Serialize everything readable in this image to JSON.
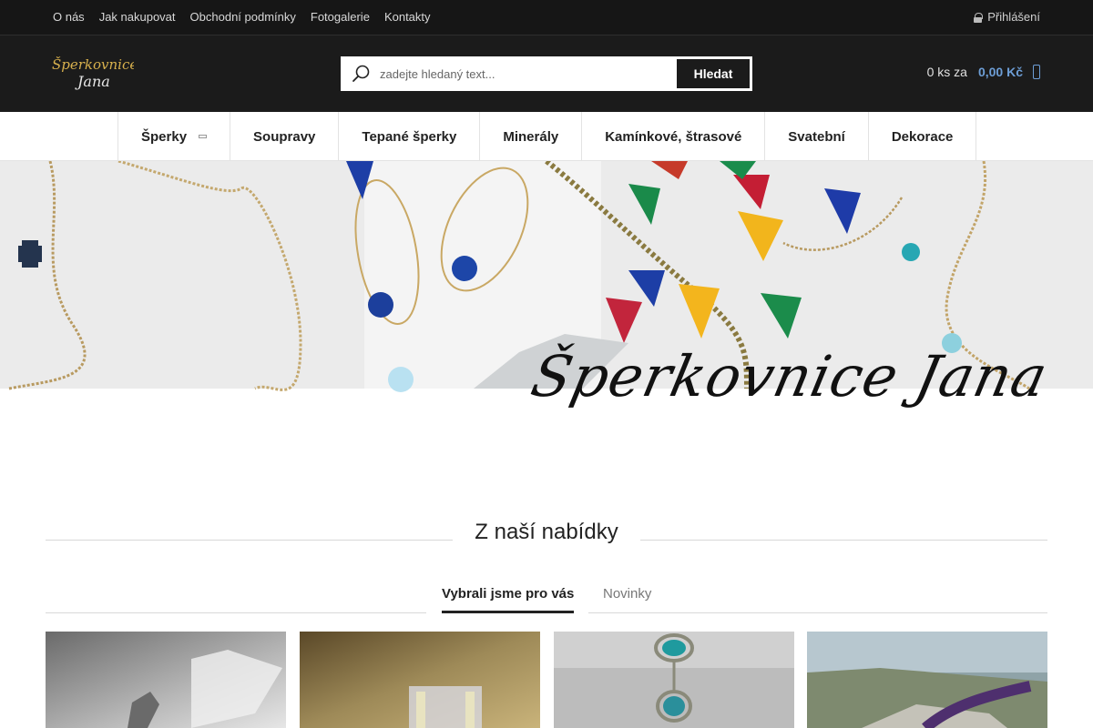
{
  "topbar": {
    "links": [
      "O nás",
      "Jak nakupovat",
      "Obchodní podmínky",
      "Fotogalerie",
      "Kontakty"
    ],
    "login_label": "Přihlášení"
  },
  "header": {
    "logo_text": [
      "Šperkovnice",
      "Jana"
    ],
    "search": {
      "placeholder": "zadejte hledaný text...",
      "button_label": "Hledat"
    },
    "cart": {
      "count_label": "0 ks za",
      "price": "0,00 Kč"
    }
  },
  "mainnav": {
    "items": [
      "Šperky",
      "Soupravy",
      "Tepané šperky",
      "Minerály",
      "Kamínkové, štrasové",
      "Svatební",
      "Dekorace"
    ]
  },
  "banner": {
    "title": "Šperkovnice Jana"
  },
  "section": {
    "title": "Z naší nabídky",
    "tabs": [
      "Vybrali jsme pro vás",
      "Novinky"
    ]
  },
  "colors": {
    "accent": "#6d9ed6",
    "header_bg": "#1b1b1b",
    "topbar_bg": "#161616"
  }
}
